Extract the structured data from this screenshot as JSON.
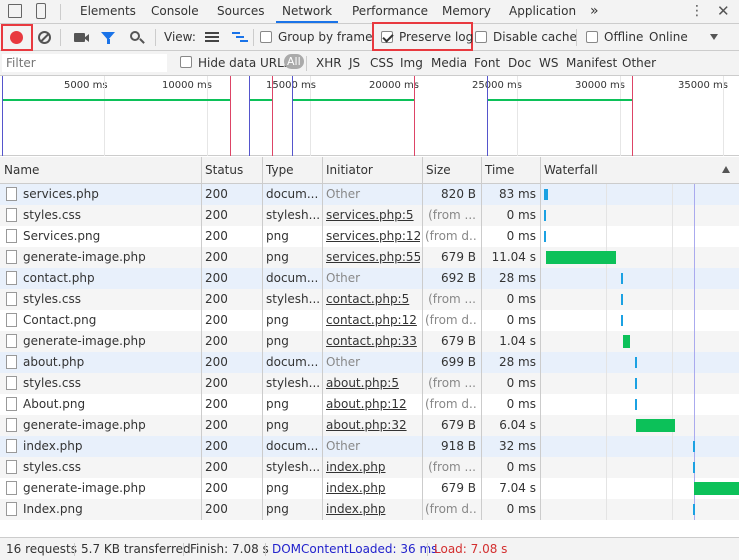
{
  "tabs": [
    {
      "label": "Elements"
    },
    {
      "label": "Console"
    },
    {
      "label": "Sources"
    },
    {
      "label": "Network"
    },
    {
      "label": "Performance"
    },
    {
      "label": "Memory"
    },
    {
      "label": "Application"
    }
  ],
  "tabs_overflow": "»",
  "toolbar": {
    "view_label": "View:",
    "group_by_frame": "Group by frame",
    "preserve_log": "Preserve log",
    "disable_cache": "Disable cache",
    "offline": "Offline",
    "throttle": "Online"
  },
  "filter": {
    "placeholder": "Filter",
    "hide_data_urls": "Hide data URLs",
    "types": [
      "All",
      "XHR",
      "JS",
      "CSS",
      "Img",
      "Media",
      "Font",
      "Doc",
      "WS",
      "Manifest",
      "Other"
    ]
  },
  "overview_ticks": [
    "5000 ms",
    "10000 ms",
    "15000 ms",
    "20000 ms",
    "25000 ms",
    "30000 ms",
    "35000 ms"
  ],
  "columns": {
    "name": "Name",
    "status": "Status",
    "type": "Type",
    "initiator": "Initiator",
    "size": "Size",
    "time": "Time",
    "waterfall": "Waterfall"
  },
  "rows": [
    {
      "name": "services.php",
      "status": "200",
      "type": "docum...",
      "initiator": "Other",
      "size": "820 B",
      "time": "83 ms",
      "wf_start": 0.0,
      "wf_dur": 0.02
    },
    {
      "name": "styles.css",
      "status": "200",
      "type": "stylesh...",
      "initiator": "services.php:5",
      "size": "(from ...",
      "time": "0 ms",
      "wf_start": 0.0,
      "wf_dur": 0.005
    },
    {
      "name": "Services.png",
      "status": "200",
      "type": "png",
      "initiator": "services.php:12",
      "size": "(from d...",
      "time": "0 ms",
      "wf_start": 0.0,
      "wf_dur": 0.005
    },
    {
      "name": "generate-image.php",
      "status": "200",
      "type": "png",
      "initiator": "services.php:55",
      "size": "679 B",
      "time": "11.04 s",
      "wf_start": 0.01,
      "wf_dur": 0.36
    },
    {
      "name": "contact.php",
      "status": "200",
      "type": "docum...",
      "initiator": "Other",
      "size": "692 B",
      "time": "28 ms",
      "wf_start": 0.395,
      "wf_dur": 0.01
    },
    {
      "name": "styles.css",
      "status": "200",
      "type": "stylesh...",
      "initiator": "contact.php:5",
      "size": "(from ...",
      "time": "0 ms",
      "wf_start": 0.395,
      "wf_dur": 0.005
    },
    {
      "name": "Contact.png",
      "status": "200",
      "type": "png",
      "initiator": "contact.php:12",
      "size": "(from d...",
      "time": "0 ms",
      "wf_start": 0.395,
      "wf_dur": 0.005
    },
    {
      "name": "generate-image.php",
      "status": "200",
      "type": "png",
      "initiator": "contact.php:33",
      "size": "679 B",
      "time": "1.04 s",
      "wf_start": 0.405,
      "wf_dur": 0.035
    },
    {
      "name": "about.php",
      "status": "200",
      "type": "docum...",
      "initiator": "Other",
      "size": "699 B",
      "time": "28 ms",
      "wf_start": 0.465,
      "wf_dur": 0.01
    },
    {
      "name": "styles.css",
      "status": "200",
      "type": "stylesh...",
      "initiator": "about.php:5",
      "size": "(from ...",
      "time": "0 ms",
      "wf_start": 0.465,
      "wf_dur": 0.005
    },
    {
      "name": "About.png",
      "status": "200",
      "type": "png",
      "initiator": "about.php:12",
      "size": "(from d...",
      "time": "0 ms",
      "wf_start": 0.465,
      "wf_dur": 0.005
    },
    {
      "name": "generate-image.php",
      "status": "200",
      "type": "png",
      "initiator": "about.php:32",
      "size": "679 B",
      "time": "6.04 s",
      "wf_start": 0.47,
      "wf_dur": 0.2
    },
    {
      "name": "index.php",
      "status": "200",
      "type": "docum...",
      "initiator": "Other",
      "size": "918 B",
      "time": "32 ms",
      "wf_start": 0.765,
      "wf_dur": 0.01
    },
    {
      "name": "styles.css",
      "status": "200",
      "type": "stylesh...",
      "initiator": "index.php",
      "size": "(from ...",
      "time": "0 ms",
      "wf_start": 0.765,
      "wf_dur": 0.005
    },
    {
      "name": "generate-image.php",
      "status": "200",
      "type": "png",
      "initiator": "index.php",
      "size": "679 B",
      "time": "7.04 s",
      "wf_start": 0.77,
      "wf_dur": 0.23
    },
    {
      "name": "Index.png",
      "status": "200",
      "type": "png",
      "initiator": "index.php",
      "size": "(from d...",
      "time": "0 ms",
      "wf_start": 0.765,
      "wf_dur": 0.005
    }
  ],
  "status_bar": {
    "requests": "16 requests",
    "transferred": "5.7 KB transferred",
    "finish": "Finish: 7.08 s",
    "dcl": "DOMContentLoaded: 36 ms",
    "load": "Load: 7.08 s"
  },
  "colors": {
    "accent": "#1a73e8",
    "record": "#e8393f",
    "bar": "#0cc159",
    "dcl": "#2222cc",
    "load": "#d32f2f"
  }
}
